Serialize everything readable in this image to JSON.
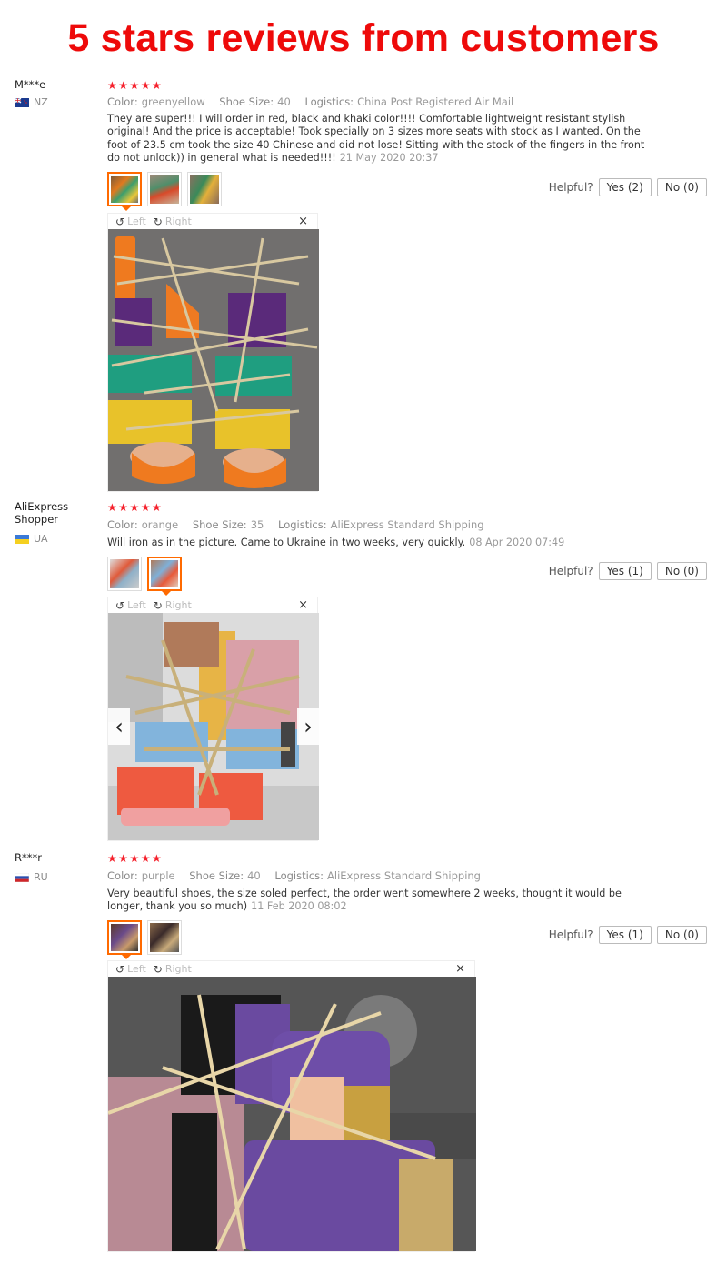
{
  "banner": {
    "title": "5 stars reviews from customers"
  },
  "reviews": [
    {
      "buyer": "M***e",
      "country": "NZ",
      "stars": "★★★★★",
      "rating": 5,
      "color_label": "Color:",
      "color": "greenyellow",
      "size_label": "Shoe Size:",
      "size": "40",
      "logistics_label": "Logistics:",
      "logistics": "China Post Registered Air Mail",
      "text": "They are super!!! I will order in red, black and khaki color!!!! Comfortable lightweight resistant stylish original! And the price is acceptable! Took specially on 3 sizes more seats with stock as I wanted. On the foot of 23.5 cm took the size 40 Chinese and did not lose! Sitting with the stock of the fingers in the front do not unlock)) in general what is needed!!!!",
      "date": "21 May 2020 20:37",
      "helpful_label": "Helpful?",
      "yes": "Yes (2)",
      "no": "No (0)",
      "viewer": {
        "left": "Left",
        "right": "Right",
        "close": "×"
      }
    },
    {
      "buyer": "AliExpress Shopper",
      "country": "UA",
      "stars": "★★★★★",
      "rating": 5,
      "color_label": "Color:",
      "color": "orange",
      "size_label": "Shoe Size:",
      "size": "35",
      "logistics_label": "Logistics:",
      "logistics": "AliExpress Standard Shipping",
      "text": "Will iron as in the picture. Came to Ukraine in two weeks, very quickly.",
      "date": "08 Apr 2020 07:49",
      "helpful_label": "Helpful?",
      "yes": "Yes (1)",
      "no": "No (0)",
      "viewer": {
        "left": "Left",
        "right": "Right",
        "close": "×",
        "prev": "‹",
        "next": "›"
      }
    },
    {
      "buyer": "R***r",
      "country": "RU",
      "stars": "★★★★★",
      "rating": 4.8,
      "color_label": "Color:",
      "color": "purple",
      "size_label": "Shoe Size:",
      "size": "40",
      "logistics_label": "Logistics:",
      "logistics": "AliExpress Standard Shipping",
      "text": "Very beautiful shoes, the size soled perfect, the order went somewhere 2 weeks, thought it would be longer, thank you so much)",
      "date": "11 Feb 2020 08:02",
      "helpful_label": "Helpful?",
      "yes": "Yes (1)",
      "no": "No (0)",
      "viewer": {
        "left": "Left",
        "right": "Right",
        "close": "×"
      }
    }
  ]
}
